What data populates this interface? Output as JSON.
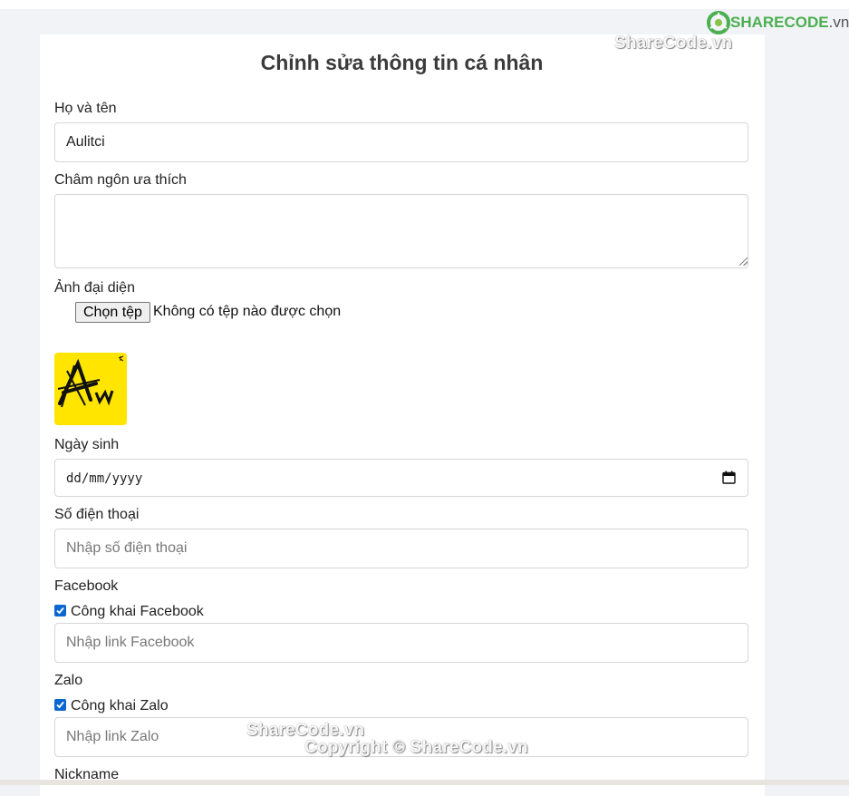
{
  "logo": {
    "brand": "SHARECODE",
    "tld": ".vn",
    "color": "#4caf50"
  },
  "watermarks": {
    "top": "ShareCode.vn",
    "middle": "ShareCode.vn",
    "copyright": "Copyright © ShareCode.vn"
  },
  "form": {
    "title": "Chỉnh sửa thông tin cá nhân",
    "name": {
      "label": "Họ và tên",
      "value": "Aulitci"
    },
    "motto": {
      "label": "Châm ngôn ưa thích",
      "value": ""
    },
    "avatar": {
      "label": "Ảnh đại diện",
      "button": "Chọn tệp",
      "status": "Không có tệp nào được chọn",
      "image_color": "#ffe500"
    },
    "birthday": {
      "label": "Ngày sinh",
      "placeholder": "dd/mm/yyyy"
    },
    "phone": {
      "label": "Số điện thoại",
      "placeholder": "Nhập số điện thoại"
    },
    "facebook": {
      "label": "Facebook",
      "public_label": "Công khai Facebook",
      "public_checked": true,
      "placeholder": "Nhập link Facebook"
    },
    "zalo": {
      "label": "Zalo",
      "public_label": "Công khai Zalo",
      "public_checked": true,
      "placeholder": "Nhập link Zalo"
    },
    "nickname": {
      "label": "Nickname"
    }
  },
  "accent": "#0b67d0"
}
